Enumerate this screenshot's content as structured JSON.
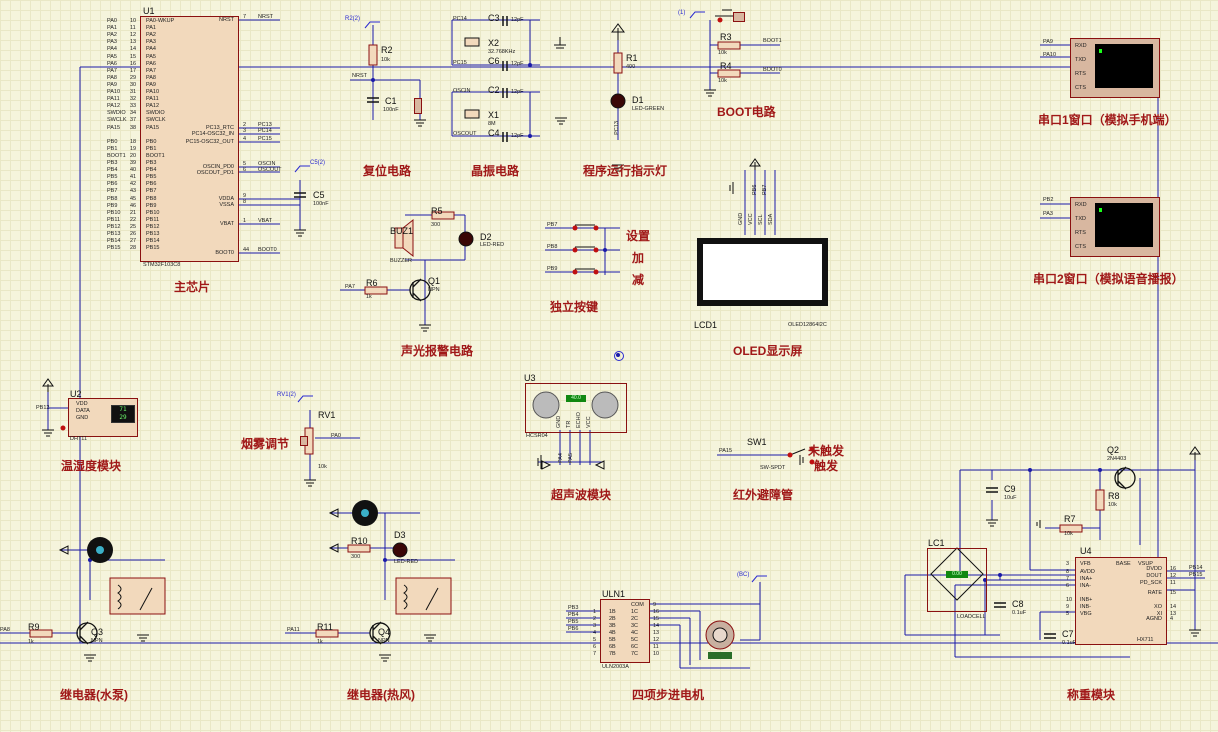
{
  "sections": {
    "main_chip": "主芯片",
    "reset": "复位电路",
    "crystal": "晶振电路",
    "indicator": "程序运行指示灯",
    "boot": "BOOT电路",
    "uart1": "串口1窗口（模拟手机端）",
    "uart2": "串口2窗口（模拟语音播报）",
    "keys": "独立按键",
    "alarm": "声光报警电路",
    "oled": "OLED显示屏",
    "dht": "温湿度模块",
    "smoke": "烟雾调节",
    "ultrasonic": "超声波模块",
    "ir": "红外避障管",
    "relay_pump": "继电器(水泵)",
    "relay_heat": "继电器(热风)",
    "stepper": "四项步进电机",
    "weigh": "称重模块",
    "key_set": "设置",
    "key_add": "加",
    "key_sub": "减",
    "not_trig": "未触发",
    "trig": "触发"
  },
  "mcu": {
    "ref": "U1",
    "part": "STM32F103C8",
    "left_pins": [
      "PA0-WKUP",
      "PA1",
      "PA2",
      "PA3",
      "PA4",
      "PA5",
      "PA6",
      "PA7",
      "PA8",
      "PA9",
      "PA10",
      "PA11",
      "PA12",
      "SWDIO",
      "SWCLK",
      "PA15",
      "",
      "PB0",
      "PB1",
      "BOOT1",
      "PB3",
      "PB4",
      "PB5",
      "PB6",
      "PB7",
      "PB8",
      "PB9",
      "PB10",
      "PB11",
      "PB12",
      "PB13",
      "PB14",
      "PB15"
    ],
    "left_nets": [
      "PA0",
      "PA1",
      "PA2",
      "PA3",
      "PA4",
      "PA5",
      "PA6",
      "PA7",
      "PA8",
      "PA9",
      "PA10",
      "PA11",
      "PA12",
      "SWDIO",
      "SWCLK",
      "PA15",
      "",
      "PB0",
      "PB1",
      "BOOT1",
      "PB3",
      "PB4",
      "PB5",
      "PB6",
      "PB7",
      "PB8",
      "PB9",
      "PB10",
      "PB11",
      "PB12",
      "PB13",
      "PB14",
      "PB15"
    ],
    "left_nums": [
      "10",
      "11",
      "12",
      "13",
      "14",
      "15",
      "16",
      "17",
      "29",
      "30",
      "31",
      "32",
      "33",
      "34",
      "37",
      "38",
      "",
      "18",
      "19",
      "20",
      "39",
      "40",
      "41",
      "42",
      "43",
      "45",
      "46",
      "21",
      "22",
      "25",
      "26",
      "27",
      "28"
    ],
    "right_pins": [
      "NRST",
      "PC13_RTC",
      "PC14-OSC32_IN",
      "PC15-OSC32_OUT",
      "OSCIN_PD0",
      "OSCOUT_PD1",
      "VDDA",
      "VSSA",
      "VBAT",
      "BOOT0"
    ],
    "right_nets": [
      "NRST",
      "PC13",
      "PC14",
      "PC15",
      "OSCIN",
      "OSCOUT",
      "",
      "",
      "VBAT",
      "BOOT0"
    ],
    "right_nums": [
      "7",
      "2",
      "3",
      "4",
      "5",
      "6",
      "9",
      "8",
      "1",
      "44"
    ]
  },
  "reset": {
    "r_ref": "R2",
    "r_val": "10k",
    "c_ref": "C1",
    "c_val": "100nF",
    "net": "NRST",
    "probe": "R2(2)"
  },
  "crystal": {
    "c3": "C3",
    "c3v": "12pF",
    "x2": "X2",
    "x2v": "32.768KHz",
    "c6": "C6",
    "c6v": "12pF",
    "c2": "C2",
    "c2v": "12pF",
    "x1": "X1",
    "x1v": "8M",
    "c4": "C4",
    "c4v": "12pF",
    "n1": "PC14",
    "n2": "PC15",
    "n3": "OSCIN",
    "n4": "OSCOUT"
  },
  "led": {
    "r_ref": "R1",
    "r_val": "400",
    "d_ref": "D1",
    "d_val": "LED-GREEN",
    "net": "PC13"
  },
  "boot": {
    "probe": "(1)",
    "r3": "R3",
    "r3v": "10k",
    "r4": "R4",
    "r4v": "10k",
    "n1": "BOOT1",
    "n2": "BOOT0"
  },
  "uart1": {
    "n1": "PA9",
    "n2": "PA10",
    "pins": [
      "RXD",
      "TXD",
      "RTS",
      "CTS"
    ]
  },
  "uart2": {
    "n1": "PB2",
    "n2": "PA3",
    "pins": [
      "RXD",
      "TXD",
      "RTS",
      "CTS"
    ]
  },
  "power": {
    "c5": "C5",
    "c5v": "100nF",
    "probe": "C5(2)",
    "vdd": "VBAT"
  },
  "alarm": {
    "buz": "BUZ1",
    "buzv": "BUZZER",
    "r5": "R5",
    "r5v": "300",
    "d2": "D2",
    "d2v": "LED-RED",
    "r6": "R6",
    "r6v": "1k",
    "q1": "Q1",
    "q1v": "NPN",
    "net": "PA7"
  },
  "keys": {
    "n1": "PB7",
    "n2": "PB8",
    "n3": "PB9"
  },
  "oled": {
    "ref": "LCD1",
    "part": "OLED12864I2C",
    "pins": [
      "GND",
      "VCC",
      "SCL",
      "SDA"
    ],
    "nets": [
      "PB6",
      "PB7"
    ]
  },
  "dht": {
    "ref": "U2",
    "part": "DHT11",
    "net": "PB12",
    "pins": [
      "VDD",
      "DATA",
      "GND"
    ],
    "v1": "71",
    "v2": "29"
  },
  "smoke": {
    "ref": "RV1",
    "val": "10k",
    "net": "PA0",
    "probe": "RV1(2)"
  },
  "ultra": {
    "ref": "U3",
    "part": "HCSR04",
    "reading": "40.0",
    "pins": [
      "GND",
      "TR",
      "ECHO",
      "VCC"
    ],
    "nets": [
      "PA4",
      "PA5"
    ]
  },
  "ir": {
    "ref": "SW1",
    "part": "SW-SPDT",
    "net": "PA15"
  },
  "pump": {
    "r9": "R9",
    "r9v": "1k",
    "q3": "Q3",
    "q3v": "NPN",
    "net": "PA8"
  },
  "heat": {
    "r10": "R10",
    "r10v": "300",
    "d3": "D3",
    "d3v": "LED-RED",
    "r11": "R11",
    "r11v": "1k",
    "q4": "Q4",
    "q4v": "NPN",
    "net": "PA11"
  },
  "stepper": {
    "ref": "ULN1",
    "part": "ULN2003A",
    "probe": "(BC)",
    "in_nets": [
      "PB3",
      "PB4",
      "PB5",
      "PB6"
    ],
    "in_pins": [
      "1B",
      "2B",
      "3B",
      "4B",
      "5B",
      "6B",
      "7B"
    ],
    "out_pins": [
      "COM",
      "1C",
      "2C",
      "3C",
      "4C",
      "5C",
      "6C",
      "7C"
    ],
    "in_nums": [
      "1",
      "2",
      "3",
      "4",
      "5",
      "6",
      "7"
    ],
    "out_nums": [
      "9",
      "16",
      "15",
      "14",
      "13",
      "12",
      "11",
      "10"
    ]
  },
  "weigh": {
    "q2": "Q2",
    "q2v": "2N4403",
    "c9": "C9",
    "c9v": "10uF",
    "r8": "R8",
    "r8v": "10k",
    "r7": "R7",
    "r7v": "10k",
    "lc": "LC1",
    "lcv": "LOADCELL",
    "c8": "C8",
    "c8v": "0.1uF",
    "c7": "C7",
    "c7v": "0.1uF",
    "u4": "U4",
    "u4v": "HX711",
    "cell": "0.00",
    "left_pins": [
      "VFB",
      "AVDD",
      "INA+",
      "INA-",
      "INB+",
      "INB-",
      "VBG"
    ],
    "left_nums": [
      "3",
      "8",
      "7",
      "6",
      "10",
      "9",
      "5"
    ],
    "right_pins": [
      "DVDD",
      "DOUT",
      "PD_SCK",
      "RATE",
      "XO",
      "XI",
      "AGND"
    ],
    "right_nums": [
      "16",
      "12",
      "11",
      "15",
      "14",
      "13",
      "4"
    ],
    "top_pins": [
      "BASE",
      "VSUP"
    ],
    "nets": [
      "PB14",
      "PB15"
    ]
  },
  "colors": {
    "wire": "#1a1aa8",
    "part": "#8a1010",
    "fill": "#f2d9bc",
    "label": "#a01818",
    "ground": "#111111",
    "probe": "#2a2ad0"
  }
}
